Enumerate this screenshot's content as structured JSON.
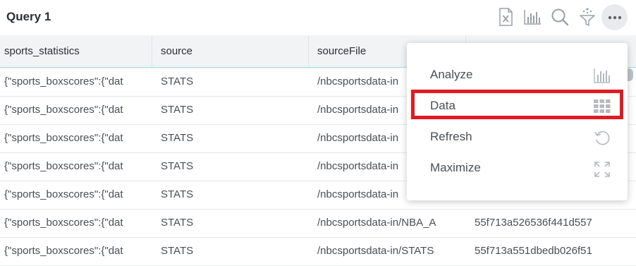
{
  "header": {
    "title": "Query 1",
    "icons": [
      "excel-export-icon",
      "chart-icon",
      "search-icon",
      "ai-sparkle-icon",
      "more-options-icon"
    ]
  },
  "table": {
    "columns": [
      "sports_statistics",
      "source",
      "sourceFile",
      ""
    ],
    "rows": [
      [
        "{\"sports_boxscores\":{\"dat",
        "STATS",
        "/nbcsportsdata-in",
        ""
      ],
      [
        "{\"sports_boxscores\":{\"dat",
        "STATS",
        "/nbcsportsdata-in",
        ""
      ],
      [
        "{\"sports_boxscores\":{\"dat",
        "STATS",
        "/nbcsportsdata-in",
        ""
      ],
      [
        "{\"sports_boxscores\":{\"dat",
        "STATS",
        "/nbcsportsdata-in",
        ""
      ],
      [
        "{\"sports_boxscores\":{\"dat",
        "STATS",
        "/nbcsportsdata-in",
        ""
      ],
      [
        "{\"sports_boxscores\":{\"dat",
        "STATS",
        "/nbcsportsdata-in/NBA_A",
        "55f713a526536f441d557"
      ],
      [
        "{\"sports_boxscores\":{\"dat",
        "STATS",
        "/nbcsportsdata-in/STATS",
        "55f713a551dbedb026f51"
      ]
    ]
  },
  "menu": {
    "items": [
      {
        "label": "Analyze",
        "icon": "bar-chart-icon"
      },
      {
        "label": "Data",
        "icon": "grid-icon",
        "highlighted": true
      },
      {
        "label": "Refresh",
        "icon": "refresh-icon"
      },
      {
        "label": "Maximize",
        "icon": "maximize-icon"
      }
    ]
  },
  "colors": {
    "highlight": "#e01b22",
    "header_bg": "#f1f3f5",
    "header_border": "#a8d4ef",
    "icon_gray": "#9aa0a6"
  }
}
